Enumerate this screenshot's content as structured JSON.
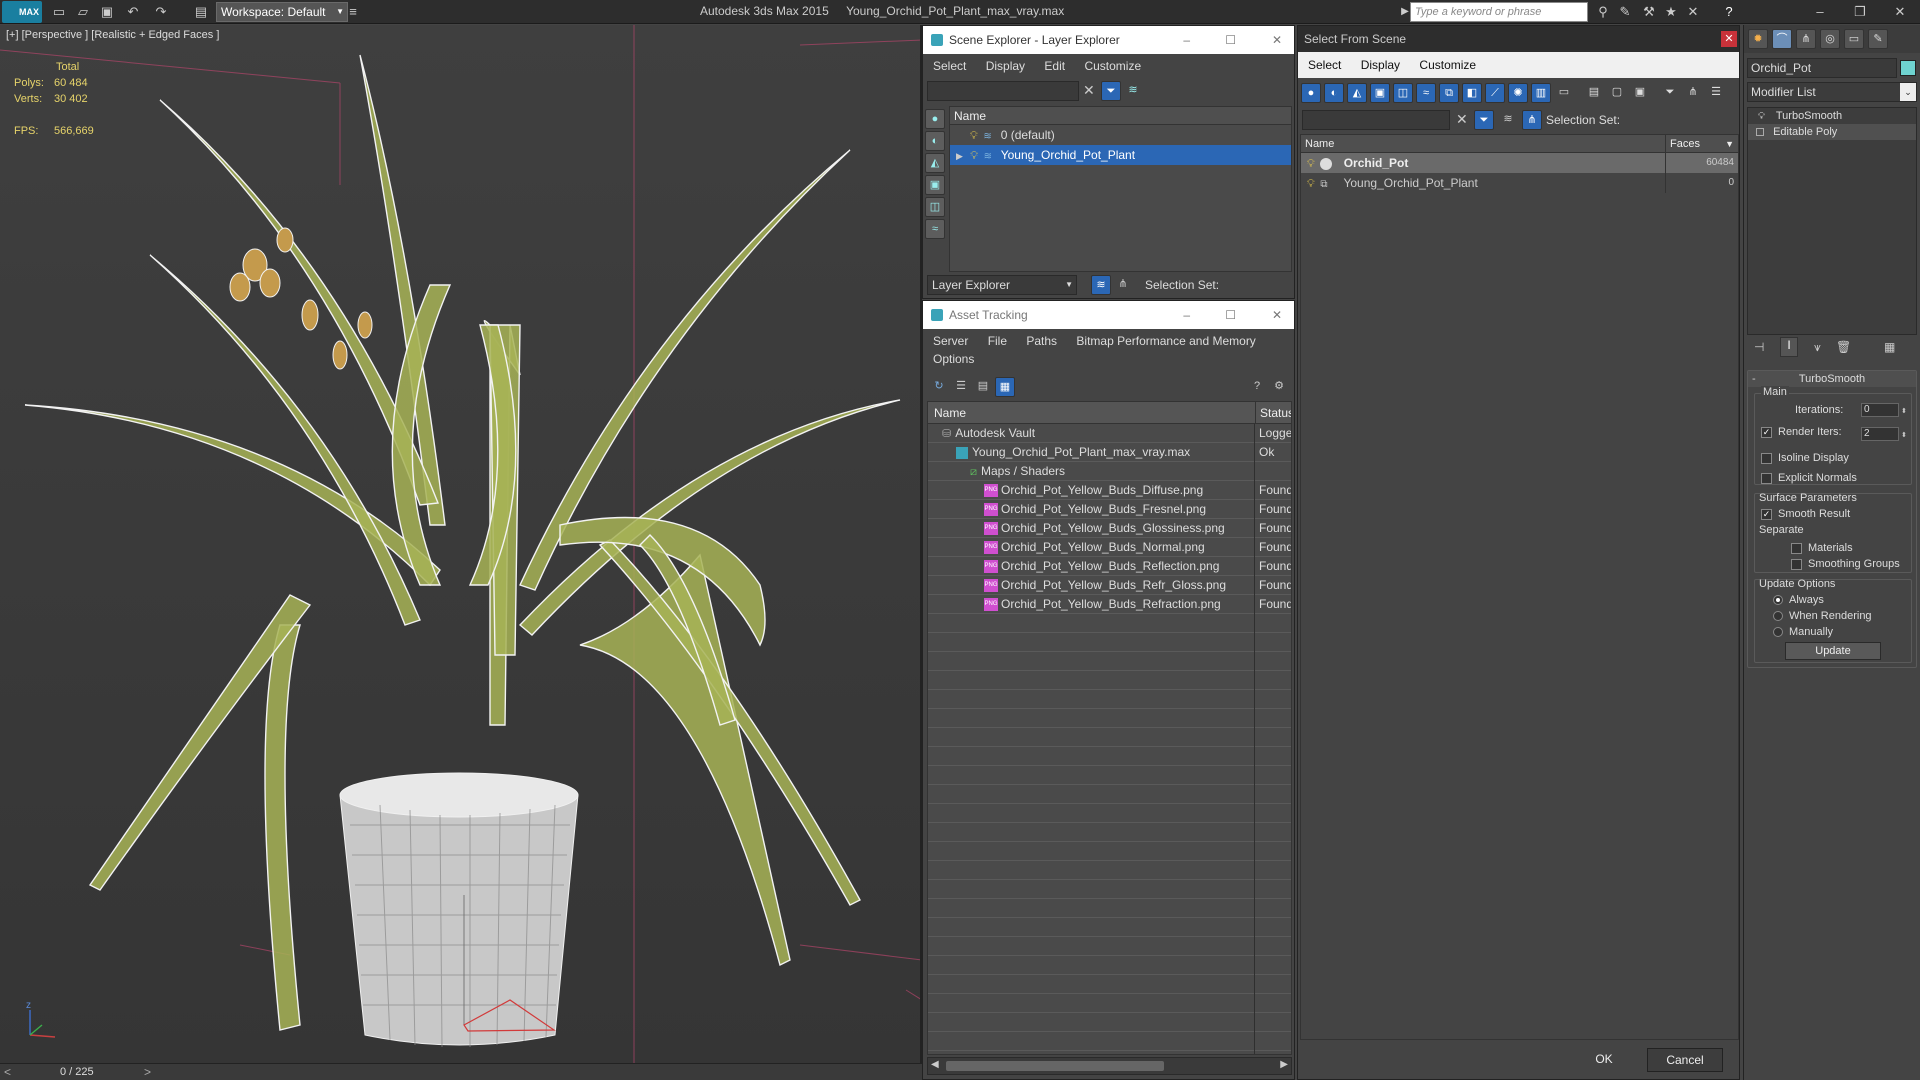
{
  "titlebar": {
    "logo": "MAX",
    "workspace": "Workspace: Default",
    "app_name": "Autodesk 3ds Max  2015",
    "file_name": "Young_Orchid_Pot_Plant_max_vray.max",
    "search_placeholder": "Type a keyword or phrase"
  },
  "viewport": {
    "label": "[+] [Perspective ] [Realistic + Edged Faces ]",
    "stats": {
      "total_label": "Total",
      "polys_label": "Polys:",
      "polys": "60 484",
      "verts_label": "Verts:",
      "verts": "30 402",
      "fps_label": "FPS:",
      "fps": "566,669"
    },
    "axis_z": "z",
    "timeline": "0 / 225"
  },
  "scene_explorer": {
    "title": "Scene Explorer - Layer Explorer",
    "menu": [
      "Select",
      "Display",
      "Edit",
      "Customize"
    ],
    "column": "Name",
    "rows": [
      {
        "name": "0 (default)",
        "selected": false
      },
      {
        "name": "Young_Orchid_Pot_Plant",
        "selected": true
      }
    ],
    "footer_dropdown": "Layer Explorer",
    "selection_set": "Selection Set:"
  },
  "asset_tracking": {
    "title": "Asset Tracking",
    "menu": [
      "Server",
      "File",
      "Paths",
      "Bitmap Performance and Memory"
    ],
    "menu2": "Options",
    "col_name": "Name",
    "col_status": "Status",
    "rows": [
      {
        "name": "Autodesk Vault",
        "status": "Logge",
        "indent": 1,
        "icon": "vault"
      },
      {
        "name": "Young_Orchid_Pot_Plant_max_vray.max",
        "status": "Ok",
        "indent": 2,
        "icon": "max"
      },
      {
        "name": "Maps / Shaders",
        "status": "",
        "indent": 3,
        "icon": "maps"
      },
      {
        "name": "Orchid_Pot_Yellow_Buds_Diffuse.png",
        "status": "Found",
        "indent": 4,
        "icon": "png"
      },
      {
        "name": "Orchid_Pot_Yellow_Buds_Fresnel.png",
        "status": "Found",
        "indent": 4,
        "icon": "png"
      },
      {
        "name": "Orchid_Pot_Yellow_Buds_Glossiness.png",
        "status": "Found",
        "indent": 4,
        "icon": "png"
      },
      {
        "name": "Orchid_Pot_Yellow_Buds_Normal.png",
        "status": "Found",
        "indent": 4,
        "icon": "png"
      },
      {
        "name": "Orchid_Pot_Yellow_Buds_Reflection.png",
        "status": "Found",
        "indent": 4,
        "icon": "png"
      },
      {
        "name": "Orchid_Pot_Yellow_Buds_Refr_Gloss.png",
        "status": "Found",
        "indent": 4,
        "icon": "png"
      },
      {
        "name": "Orchid_Pot_Yellow_Buds_Refraction.png",
        "status": "Found",
        "indent": 4,
        "icon": "png"
      }
    ],
    "png_tag": "PNG"
  },
  "select_from_scene": {
    "title": "Select From Scene",
    "menu": [
      "Select",
      "Display",
      "Customize"
    ],
    "selection_set": "Selection Set:",
    "col_name": "Name",
    "col_faces": "Faces",
    "rows": [
      {
        "name": "Orchid_Pot",
        "faces": "60484",
        "selected": true
      },
      {
        "name": "Young_Orchid_Pot_Plant",
        "faces": "0",
        "selected": false
      }
    ],
    "ok": "OK",
    "cancel": "Cancel"
  },
  "command_panel": {
    "object_name": "Orchid_Pot",
    "modifier_list": "Modifier List",
    "stack": [
      "TurboSmooth",
      "Editable Poly"
    ],
    "rollout_title": "TurboSmooth",
    "main_label": "Main",
    "iterations_label": "Iterations:",
    "iterations": "0",
    "render_iters_label": "Render Iters:",
    "render_iters": "2",
    "isoline": "Isoline Display",
    "explicit_normals": "Explicit Normals",
    "surface_params": "Surface Parameters",
    "smooth_result": "Smooth Result",
    "separate": "Separate",
    "materials": "Materials",
    "smoothing_groups": "Smoothing Groups",
    "update_options": "Update Options",
    "always": "Always",
    "when_rendering": "When Rendering",
    "manually": "Manually",
    "update_btn": "Update"
  },
  "colors": {
    "selection_blue": "#2b67b5",
    "stats_yellow": "#e6d36a",
    "leaf_green": "#9aa84a"
  }
}
